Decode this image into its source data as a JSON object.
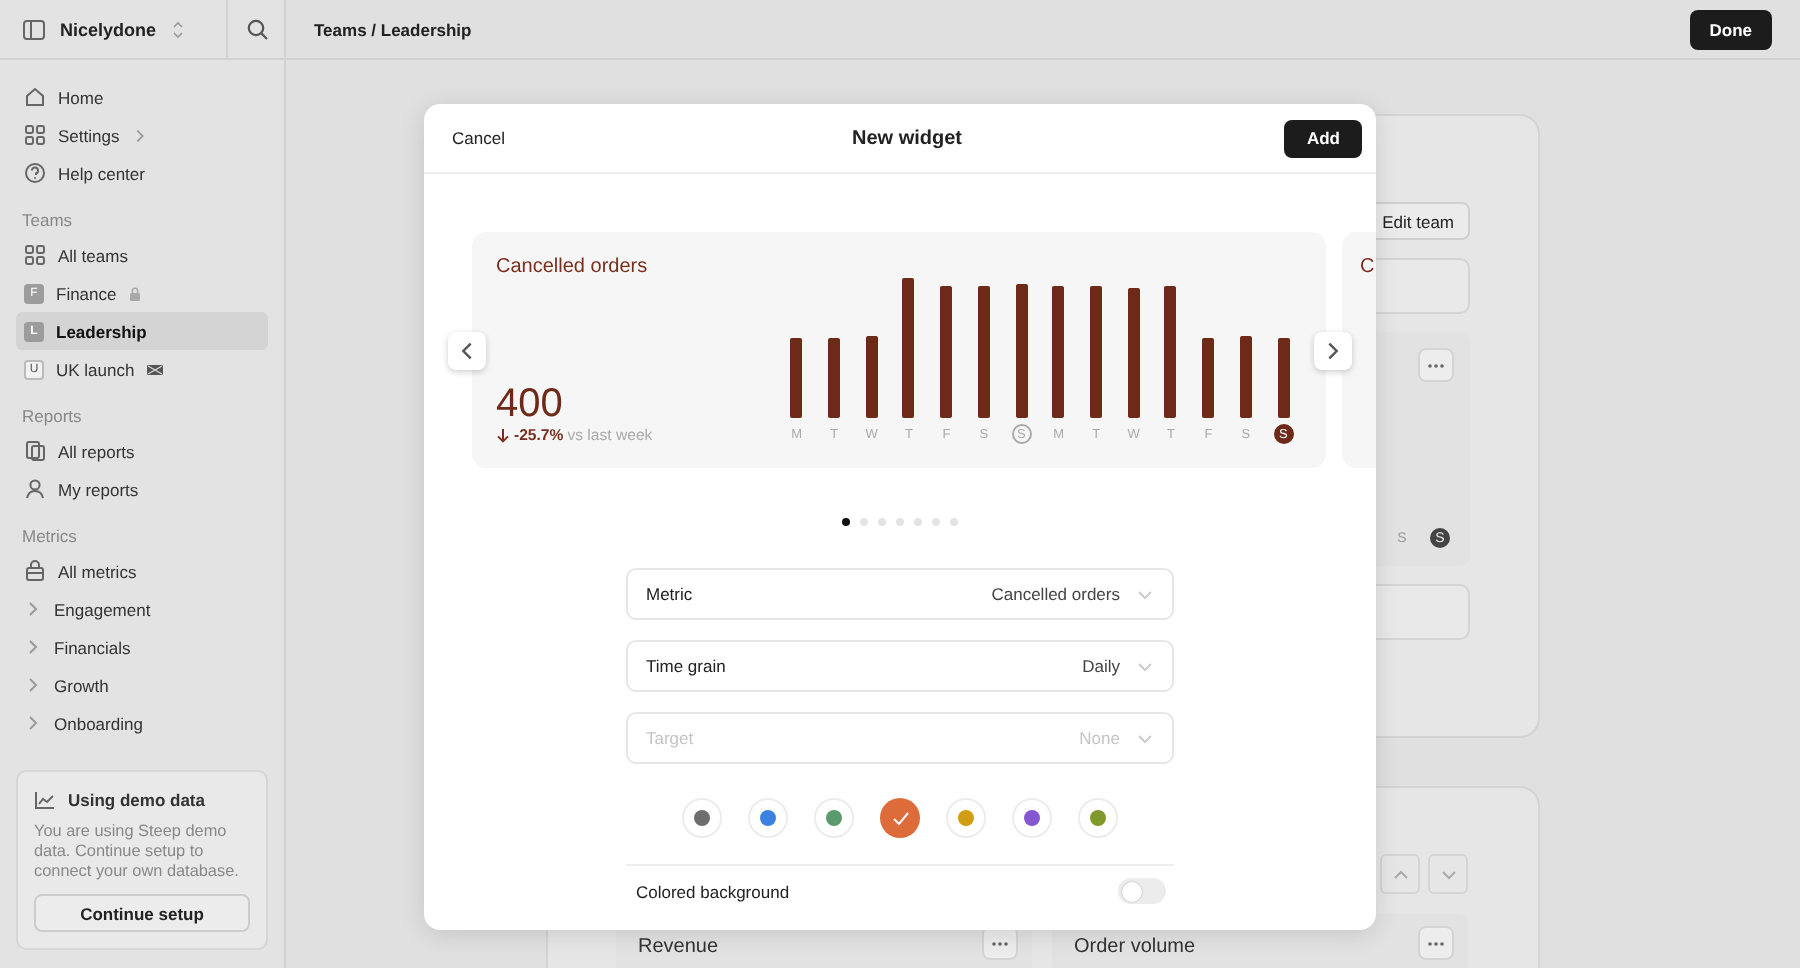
{
  "sidebar": {
    "workspace": "Nicelydone",
    "nav": [
      {
        "label": "Home",
        "kind": "home",
        "chevron": false,
        "selected": false
      },
      {
        "label": "Settings",
        "kind": "grid",
        "chevron": true,
        "selected": false
      },
      {
        "label": "Help center",
        "kind": "help",
        "chevron": false,
        "selected": false
      }
    ],
    "sections": [
      {
        "title": "Teams",
        "items": [
          {
            "label": "All teams",
            "kind": "grid",
            "selected": false
          },
          {
            "label": "Finance",
            "kind": "letter",
            "letter": "F",
            "locked": true,
            "flagged": false,
            "selected": false
          },
          {
            "label": "Leadership",
            "kind": "letter",
            "letter": "L",
            "locked": false,
            "flagged": false,
            "selected": true
          },
          {
            "label": "UK launch",
            "kind": "letter",
            "letter": "U",
            "locked": false,
            "flagged": true,
            "selected": false
          }
        ]
      },
      {
        "title": "Reports",
        "items": [
          {
            "label": "All reports",
            "kind": "report",
            "selected": false
          },
          {
            "label": "My reports",
            "kind": "person",
            "selected": false
          }
        ]
      },
      {
        "title": "Metrics",
        "items": [
          {
            "label": "All metrics",
            "kind": "bag",
            "selected": false
          },
          {
            "label": "Engagement",
            "kind": "folder",
            "selected": false
          },
          {
            "label": "Financials",
            "kind": "folder",
            "selected": false
          },
          {
            "label": "Growth",
            "kind": "folder",
            "selected": false
          },
          {
            "label": "Onboarding",
            "kind": "folder",
            "selected": false
          }
        ]
      }
    ],
    "demo": {
      "title": "Using demo data",
      "text": "You are using Steep demo data. Continue setup to connect your own database.",
      "button": "Continue setup"
    }
  },
  "topbar": {
    "breadcrumb": "Teams / Leadership",
    "button": "Done"
  },
  "background": {
    "edit_button": "Edit team",
    "axis_labels": [
      {
        "label": "S",
        "highlighted": false
      },
      {
        "label": "S",
        "highlighted": true
      }
    ],
    "cards": [
      {
        "title": "Revenue"
      },
      {
        "title": "Order volume"
      }
    ]
  },
  "modal": {
    "cancel": "Cancel",
    "title": "New widget",
    "add": "Add",
    "slide": {
      "title": "Cancelled orders",
      "value": "400",
      "change": "-25.7%",
      "comparison": "vs last week",
      "days": [
        {
          "label": "M",
          "circled": false,
          "highlighted": false
        },
        {
          "label": "T",
          "circled": false,
          "highlighted": false
        },
        {
          "label": "W",
          "circled": false,
          "highlighted": false
        },
        {
          "label": "T",
          "circled": false,
          "highlighted": false
        },
        {
          "label": "F",
          "circled": false,
          "highlighted": false
        },
        {
          "label": "S",
          "circled": false,
          "highlighted": false
        },
        {
          "label": "S",
          "circled": true,
          "highlighted": false
        },
        {
          "label": "M",
          "circled": false,
          "highlighted": false
        },
        {
          "label": "T",
          "circled": false,
          "highlighted": false
        },
        {
          "label": "W",
          "circled": false,
          "highlighted": false
        },
        {
          "label": "T",
          "circled": false,
          "highlighted": false
        },
        {
          "label": "F",
          "circled": false,
          "highlighted": false
        },
        {
          "label": "S",
          "circled": false,
          "highlighted": false
        },
        {
          "label": "S",
          "circled": false,
          "highlighted": true
        }
      ]
    },
    "next_slide": {
      "title": "C"
    },
    "pager": [
      {
        "selected": true
      },
      {
        "selected": false
      },
      {
        "selected": false
      },
      {
        "selected": false
      },
      {
        "selected": false
      },
      {
        "selected": false
      },
      {
        "selected": false
      }
    ],
    "fields": [
      {
        "label": "Metric",
        "value": "Cancelled orders",
        "disabled": false
      },
      {
        "label": "Time grain",
        "value": "Daily",
        "disabled": false
      },
      {
        "label": "Target",
        "value": "None",
        "disabled": true
      }
    ],
    "colors": [
      {
        "color": "#6e6e6e",
        "selected": false
      },
      {
        "color": "#3b82e0",
        "selected": false
      },
      {
        "color": "#5b9a6c",
        "selected": false
      },
      {
        "color": "#de6c3a",
        "selected": true
      },
      {
        "color": "#d19d12",
        "selected": false
      },
      {
        "color": "#8457d0",
        "selected": false
      },
      {
        "color": "#7f9a2a",
        "selected": false
      }
    ],
    "toggle": {
      "label": "Colored background",
      "on": false
    }
  }
}
